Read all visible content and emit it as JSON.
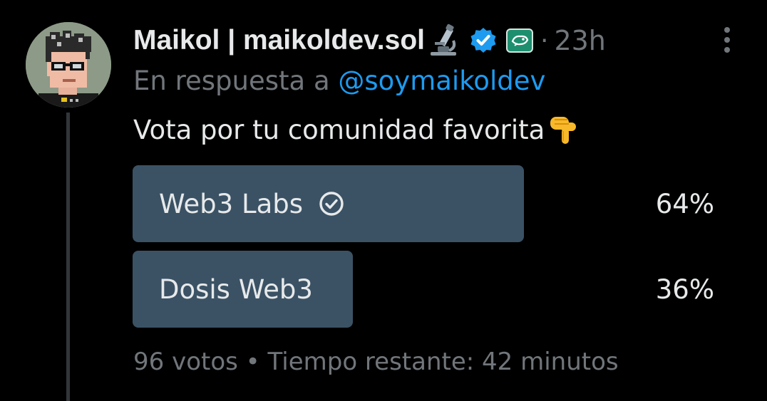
{
  "author": {
    "display_name": "Maikol | maikoldev.sol",
    "avatar_icon": "pixel-art-avatar-icon",
    "emoji_icon": "microscope-icon",
    "verified_icon": "verified-badge-icon",
    "affiliate_icon": "affiliate-badge-icon",
    "dot": "·",
    "timestamp": "23h"
  },
  "reply": {
    "prefix": "En respuesta a",
    "mention": "@soymaikoldev"
  },
  "tweet": {
    "text": "Vota por tu comunidad favorita",
    "emoji_icon": "backhand-index-pointing-down-icon"
  },
  "poll": {
    "options": [
      {
        "label": "Web3 Labs",
        "percent_label": "64%",
        "percent": 64,
        "selected": true
      },
      {
        "label": "Dosis Web3",
        "percent_label": "36%",
        "percent": 36,
        "selected": false
      }
    ],
    "votes": "96 votos",
    "separator": "•",
    "time_left": "Tiempo restante: 42 minutos"
  },
  "colors": {
    "background": "#000000",
    "text": "#e7e9ea",
    "muted": "#71767b",
    "link": "#1d9bf0",
    "poll_bar": "#3b5265",
    "verified": "#1d9bf0",
    "affiliate": "#1e8f6e",
    "thread_line": "#333639"
  }
}
